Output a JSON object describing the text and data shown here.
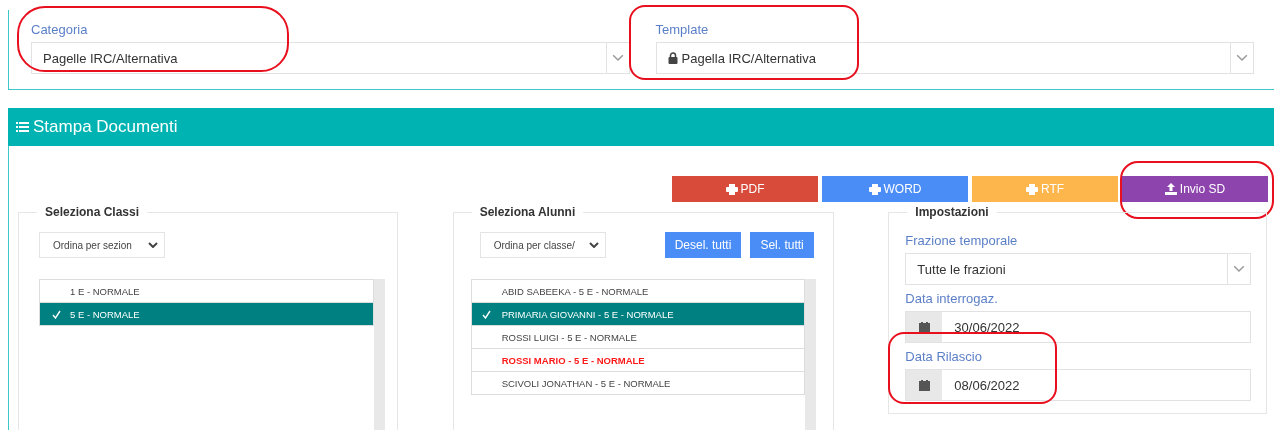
{
  "filters": [
    {
      "label": "Categoria",
      "value": "Pagelle IRC/Alternativa",
      "locked": false,
      "highlighted": true
    },
    {
      "label": "Template",
      "value": "Pagella IRC/Alternativa",
      "locked": true,
      "highlighted": true
    }
  ],
  "panel": {
    "title": "Stampa Documenti"
  },
  "export_buttons": [
    {
      "label": "PDF",
      "kind": "print",
      "color": "#d84b3a",
      "highlighted": false
    },
    {
      "label": "WORD",
      "kind": "print",
      "color": "#4b8df6",
      "highlighted": false
    },
    {
      "label": "RTF",
      "kind": "print",
      "color": "#fdb64b",
      "highlighted": false
    },
    {
      "label": "Invio SD",
      "kind": "upload",
      "color": "#8e44ad",
      "highlighted": true
    }
  ],
  "classes": {
    "title": "Seleziona Classi",
    "sort": "Ordina per sezion",
    "items": [
      {
        "label": "1 E - NORMALE",
        "selected": false
      },
      {
        "label": "5 E - NORMALE",
        "selected": true
      }
    ]
  },
  "students": {
    "title": "Seleziona Alunni",
    "sort": "Ordina per classe/",
    "buttons": [
      "Desel. tutti",
      "Sel. tutti"
    ],
    "items": [
      {
        "label": "ABID SABEEKA - 5 E - NORMALE",
        "selected": false,
        "alert": false
      },
      {
        "label": "PRIMARIA GIOVANNI - 5 E - NORMALE",
        "selected": true,
        "alert": false
      },
      {
        "label": "ROSSI LUIGI - 5 E - NORMALE",
        "selected": false,
        "alert": false
      },
      {
        "label": "ROSSI MARIO - 5 E - NORMALE",
        "selected": false,
        "alert": true
      },
      {
        "label": "SCIVOLI JONATHAN - 5 E - NORMALE",
        "selected": false,
        "alert": false
      }
    ]
  },
  "settings": {
    "title": "Impostazioni",
    "fields": [
      {
        "kind": "select",
        "label": "Frazione temporale",
        "value": "Tutte le frazioni",
        "highlighted": false
      },
      {
        "kind": "date",
        "label": "Data interrogaz.",
        "value": "30/06/2022",
        "highlighted": false
      },
      {
        "kind": "date",
        "label": "Data Rilascio",
        "value": "08/06/2022",
        "highlighted": true
      }
    ]
  }
}
